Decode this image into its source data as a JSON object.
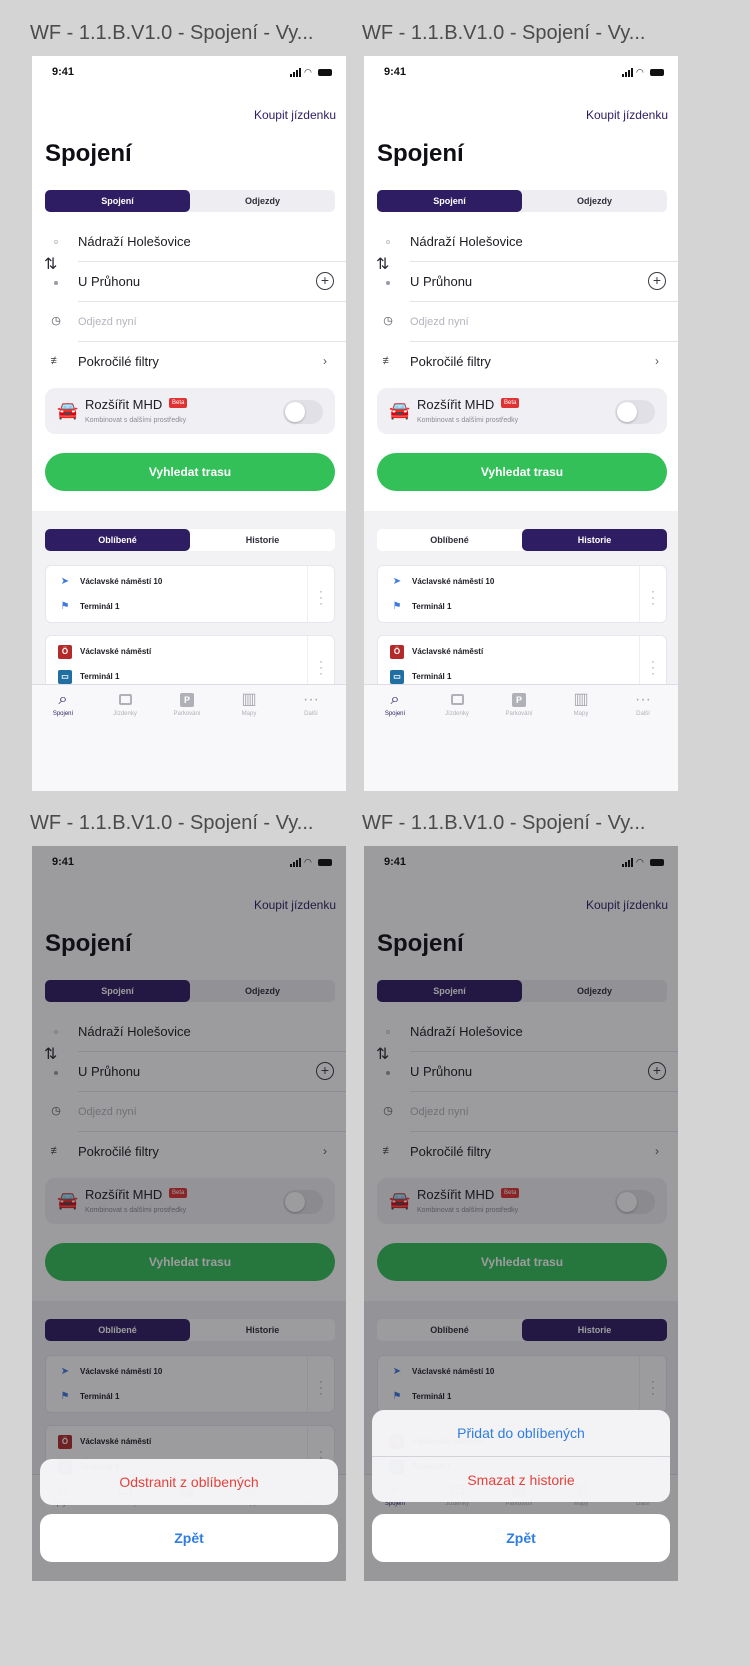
{
  "frame_title": "WF - 1.1.B.V1.0 - Spojení - Vy...",
  "status": {
    "time": "9:41"
  },
  "buy_ticket": "Koupit jízdenku",
  "page_title": "Spojení",
  "mode_tabs": {
    "left": "Spojení",
    "right": "Odjezdy"
  },
  "from": "Nádraží Holešovice",
  "to": "U Průhonu",
  "departure_placeholder": "Odjezd nyní",
  "filters": "Pokročilé filtry",
  "mhd": {
    "title": "Rozšířit MHD",
    "badge": "Beta",
    "subtitle": "Kombinovat s dalšími prostředky"
  },
  "search_button": "Vyhledat trasu",
  "list_tabs": {
    "left": "Oblíbené",
    "right": "Historie"
  },
  "cards": [
    {
      "line1": "Václavské náměstí 10",
      "line2": "Terminál 1"
    },
    {
      "line1": "Václavské náměstí",
      "line2": "Terminál 1"
    }
  ],
  "tabbar": [
    {
      "label": "Spojení",
      "icon": "search-icon"
    },
    {
      "label": "Jízdenky",
      "icon": "ticket-icon"
    },
    {
      "label": "Parkování",
      "icon": "parking-icon"
    },
    {
      "label": "Mapy",
      "icon": "map-icon"
    },
    {
      "label": "Další",
      "icon": "more-icon"
    }
  ],
  "sheet_favorites": {
    "remove": "Odstranit z oblíbených",
    "back": "Zpět"
  },
  "sheet_history": {
    "add": "Přidat do oblíbených",
    "delete": "Smazat z historie",
    "back": "Zpět"
  },
  "colors": {
    "brand": "#2e1d63",
    "green": "#34c059",
    "beta": "#e03232",
    "action_blue": "#2f7de0",
    "action_red": "#e5423c"
  }
}
